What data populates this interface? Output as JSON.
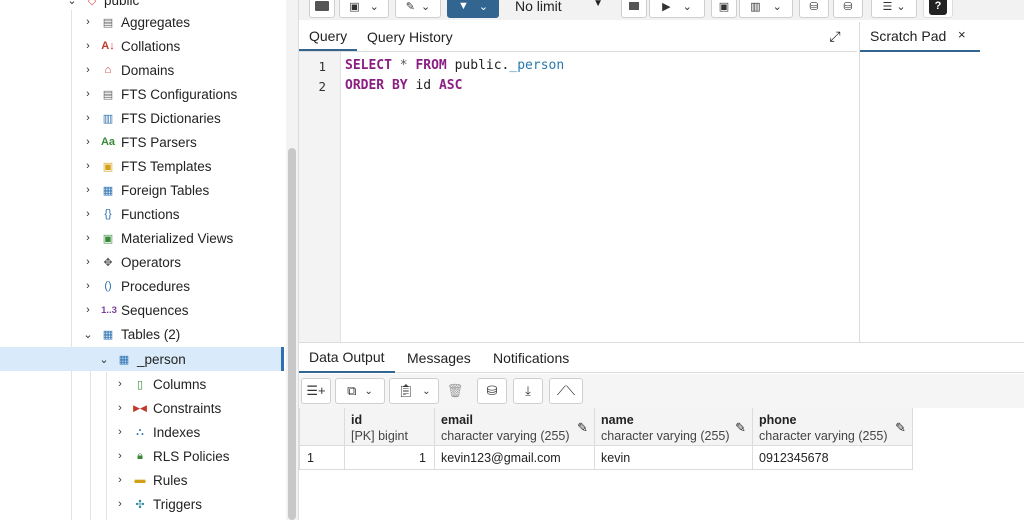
{
  "tree": {
    "top_item": "public",
    "items": [
      {
        "label": "Aggregates",
        "icon": "aggregates-icon"
      },
      {
        "label": "Collations",
        "icon": "collations-icon"
      },
      {
        "label": "Domains",
        "icon": "domains-icon"
      },
      {
        "label": "FTS Configurations",
        "icon": "fts-configurations-icon"
      },
      {
        "label": "FTS Dictionaries",
        "icon": "fts-dictionaries-icon"
      },
      {
        "label": "FTS Parsers",
        "icon": "fts-parsers-icon",
        "glyph": "Aa"
      },
      {
        "label": "FTS Templates",
        "icon": "fts-templates-icon"
      },
      {
        "label": "Foreign Tables",
        "icon": "foreign-tables-icon"
      },
      {
        "label": "Functions",
        "icon": "functions-icon"
      },
      {
        "label": "Materialized Views",
        "icon": "materialized-views-icon"
      },
      {
        "label": "Operators",
        "icon": "operators-icon"
      },
      {
        "label": "Procedures",
        "icon": "procedures-icon"
      },
      {
        "label": "Sequences",
        "icon": "sequences-icon",
        "glyph": "1..3"
      },
      {
        "label": "Tables (2)",
        "icon": "tables-icon"
      },
      {
        "label": "_person",
        "icon": "table-icon"
      },
      {
        "label": "Columns",
        "icon": "columns-icon"
      },
      {
        "label": "Constraints",
        "icon": "constraints-icon"
      },
      {
        "label": "Indexes",
        "icon": "indexes-icon"
      },
      {
        "label": "RLS Policies",
        "icon": "rls-policies-icon"
      },
      {
        "label": "Rules",
        "icon": "rules-icon"
      },
      {
        "label": "Triggers",
        "icon": "triggers-icon"
      }
    ]
  },
  "toolbar": {
    "limit_value": "No limit"
  },
  "query_tabs": [
    {
      "label": "Query"
    },
    {
      "label": "Query History"
    }
  ],
  "scratch_pad": {
    "label": "Scratch Pad",
    "close": "×"
  },
  "editor": {
    "line_numbers": [
      "1",
      "2"
    ],
    "line1": {
      "kw1": "SELECT",
      "star": " * ",
      "kw2": "FROM",
      "schema": " public.",
      "table": "_person"
    },
    "line2": {
      "kw1": "ORDER BY",
      "col": " id ",
      "kw2": "ASC"
    }
  },
  "result_tabs": [
    {
      "label": "Data Output"
    },
    {
      "label": "Messages"
    },
    {
      "label": "Notifications"
    }
  ],
  "grid": {
    "columns": [
      {
        "name": "id",
        "type": "[PK] bigint"
      },
      {
        "name": "email",
        "type": "character varying (255)"
      },
      {
        "name": "name",
        "type": "character varying (255)"
      },
      {
        "name": "phone",
        "type": "character varying (255)"
      }
    ],
    "rows": [
      {
        "row_num": "1",
        "id": "1",
        "email": "kevin123@gmail.com",
        "name": "kevin",
        "phone": "0912345678"
      }
    ]
  },
  "colors": {
    "accent": "#326690",
    "selection": "#d9ebfb",
    "keyword": "#8a1e84"
  }
}
